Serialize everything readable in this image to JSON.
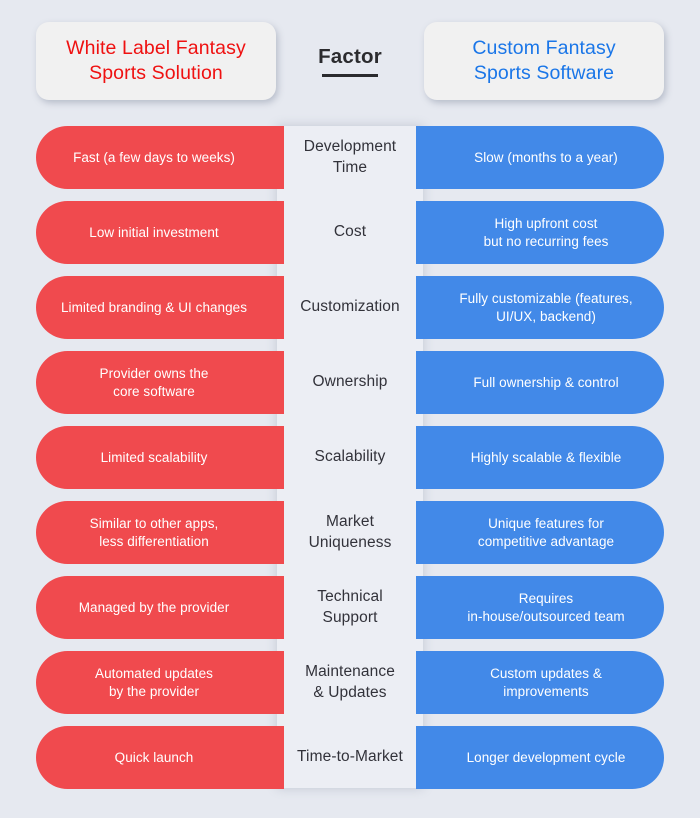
{
  "page": {
    "background_color": "#e6e9f0",
    "red_color": "#f04a4e",
    "blue_color": "#4289e8",
    "center_panel_color": "#eceef4"
  },
  "header": {
    "left_title_line1": "White Label Fantasy",
    "left_title_line2": "Sports Solution",
    "left_title_color": "#ef1111",
    "center_title": "Factor",
    "right_title_line1": "Custom Fantasy",
    "right_title_line2": "Sports Software",
    "right_title_color": "#1a76e8"
  },
  "chart_data": {
    "type": "table",
    "title": "White Label Fantasy Sports Solution vs Custom Fantasy Sports Software",
    "columns": [
      "White Label Fantasy Sports Solution",
      "Factor",
      "Custom Fantasy Sports Software"
    ],
    "rows": [
      {
        "factor": "Development Time",
        "factor_lines": [
          "Development",
          "Time"
        ],
        "left": "Fast (a few days to weeks)",
        "left_lines": [
          "Fast (a few days to weeks)"
        ],
        "right": "Slow (months to a year)",
        "right_lines": [
          "Slow (months to a year)"
        ]
      },
      {
        "factor": "Cost",
        "factor_lines": [
          "Cost"
        ],
        "left": "Low initial investment",
        "left_lines": [
          "Low initial investment"
        ],
        "right": "High upfront cost but no recurring fees",
        "right_lines": [
          "High upfront cost",
          "but no recurring fees"
        ]
      },
      {
        "factor": "Customization",
        "factor_lines": [
          "Customization"
        ],
        "left": "Limited branding & UI changes",
        "left_lines": [
          "Limited branding & UI changes"
        ],
        "right": "Fully customizable (features, UI/UX, backend)",
        "right_lines": [
          "Fully customizable (features,",
          "UI/UX, backend)"
        ]
      },
      {
        "factor": "Ownership",
        "factor_lines": [
          "Ownership"
        ],
        "left": "Provider owns the core software",
        "left_lines": [
          "Provider owns the",
          "core software"
        ],
        "right": "Full ownership & control",
        "right_lines": [
          "Full ownership & control"
        ]
      },
      {
        "factor": "Scalability",
        "factor_lines": [
          "Scalability"
        ],
        "left": "Limited scalability",
        "left_lines": [
          "Limited scalability"
        ],
        "right": "Highly scalable & flexible",
        "right_lines": [
          "Highly scalable & flexible"
        ]
      },
      {
        "factor": "Market Uniqueness",
        "factor_lines": [
          "Market",
          "Uniqueness"
        ],
        "left": "Similar to other apps, less differentiation",
        "left_lines": [
          "Similar to other apps,",
          "less differentiation"
        ],
        "right": "Unique features for competitive advantage",
        "right_lines": [
          "Unique features for",
          "competitive advantage"
        ]
      },
      {
        "factor": "Technical Support",
        "factor_lines": [
          "Technical",
          "Support"
        ],
        "left": "Managed by the provider",
        "left_lines": [
          "Managed by the provider"
        ],
        "right": "Requires in-house/outsourced team",
        "right_lines": [
          "Requires",
          "in-house/outsourced team"
        ]
      },
      {
        "factor": "Maintenance & Updates",
        "factor_lines": [
          "Maintenance",
          "& Updates"
        ],
        "left": "Automated updates by the provider",
        "left_lines": [
          "Automated updates",
          "by the provider"
        ],
        "right": "Custom updates & improvements",
        "right_lines": [
          "Custom updates &",
          "improvements"
        ]
      },
      {
        "factor": "Time-to-Market",
        "factor_lines": [
          "Time-to-Market"
        ],
        "left": "Quick launch",
        "left_lines": [
          "Quick launch"
        ],
        "right": "Longer development cycle",
        "right_lines": [
          "Longer development cycle"
        ]
      }
    ]
  }
}
